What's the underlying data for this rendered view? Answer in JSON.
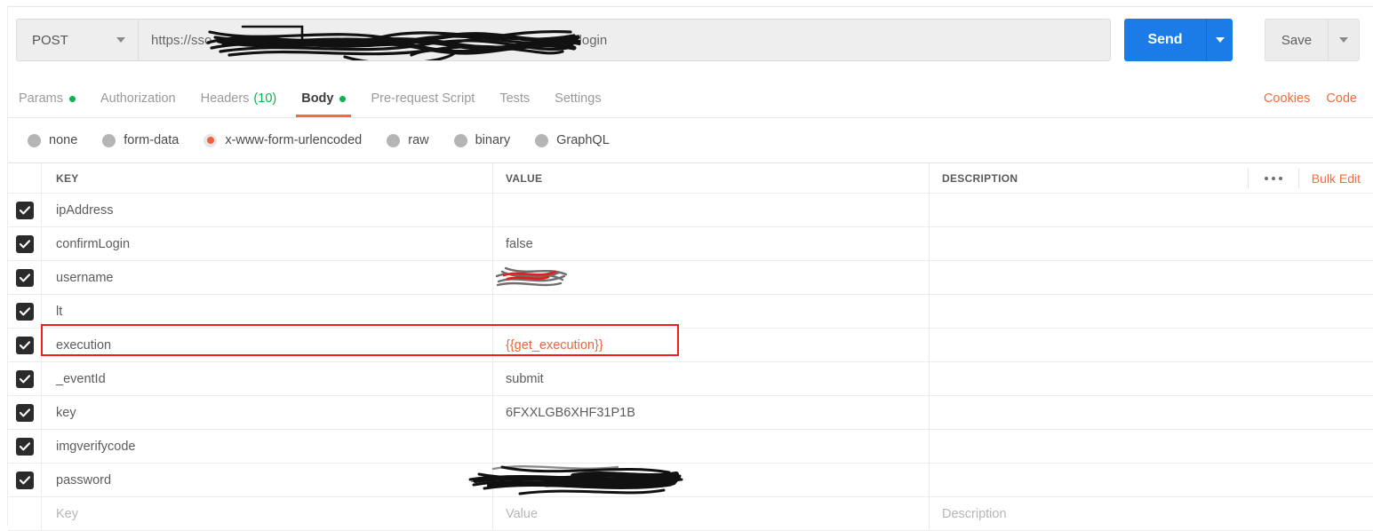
{
  "request_bar": {
    "method": "POST",
    "method_caret_icon": "chevron-down-icon",
    "url_prefix": "https://sso",
    "url_suffix": "/login",
    "url_redacted": true,
    "send_label": "Send",
    "send_caret_icon": "chevron-down-icon",
    "save_label": "Save",
    "save_caret_icon": "chevron-down-icon",
    "send_color": "#1b7ce8"
  },
  "tabs": {
    "items": [
      {
        "label": "Params",
        "has_dot": true,
        "count": "",
        "active": false
      },
      {
        "label": "Authorization",
        "has_dot": false,
        "count": "",
        "active": false
      },
      {
        "label": "Headers",
        "has_dot": false,
        "count": "(10)",
        "active": false
      },
      {
        "label": "Body",
        "has_dot": true,
        "count": "",
        "active": true
      },
      {
        "label": "Pre-request Script",
        "has_dot": false,
        "count": "",
        "active": false
      },
      {
        "label": "Tests",
        "has_dot": false,
        "count": "",
        "active": false
      },
      {
        "label": "Settings",
        "has_dot": false,
        "count": "",
        "active": false
      }
    ],
    "right_links": [
      "Cookies",
      "Code"
    ],
    "active_underline_color": "#ef6c3f",
    "dot_color": "#0cb14b"
  },
  "body_types": {
    "options": [
      {
        "label": "none",
        "selected": false
      },
      {
        "label": "form-data",
        "selected": false
      },
      {
        "label": "x-www-form-urlencoded",
        "selected": true
      },
      {
        "label": "raw",
        "selected": false
      },
      {
        "label": "binary",
        "selected": false
      },
      {
        "label": "GraphQL",
        "selected": false
      }
    ],
    "selected_color": "#f2613f"
  },
  "table": {
    "headers": {
      "key": "KEY",
      "value": "VALUE",
      "description": "DESCRIPTION"
    },
    "more_icon": "ellipsis-icon",
    "bulk_edit_label": "Bulk Edit",
    "rows": [
      {
        "checked": true,
        "key": "ipAddress",
        "value": "",
        "description": "",
        "redacted": false,
        "highlighted": false,
        "variable": false
      },
      {
        "checked": true,
        "key": "confirmLogin",
        "value": "false",
        "description": "",
        "redacted": false,
        "highlighted": false,
        "variable": false
      },
      {
        "checked": true,
        "key": "username",
        "value": "",
        "description": "",
        "redacted": true,
        "highlighted": false,
        "variable": false
      },
      {
        "checked": true,
        "key": "lt",
        "value": "",
        "description": "",
        "redacted": false,
        "highlighted": false,
        "variable": false
      },
      {
        "checked": true,
        "key": "execution",
        "value": "{{get_execution}}",
        "description": "",
        "redacted": false,
        "highlighted": true,
        "variable": true
      },
      {
        "checked": true,
        "key": "_eventId",
        "value": "submit",
        "description": "",
        "redacted": false,
        "highlighted": false,
        "variable": false
      },
      {
        "checked": true,
        "key": "key",
        "value": "6FXXLGB6XHF31P1B",
        "description": "",
        "redacted": false,
        "highlighted": false,
        "variable": false
      },
      {
        "checked": true,
        "key": "imgverifycode",
        "value": "",
        "description": "",
        "redacted": false,
        "highlighted": false,
        "variable": false
      },
      {
        "checked": true,
        "key": "password",
        "value": "",
        "description": "",
        "redacted": true,
        "highlighted": false,
        "variable": false
      }
    ],
    "new_row_placeholders": {
      "key": "Key",
      "value": "Value",
      "description": "Description"
    },
    "annotation_color": "#f01e1e"
  }
}
